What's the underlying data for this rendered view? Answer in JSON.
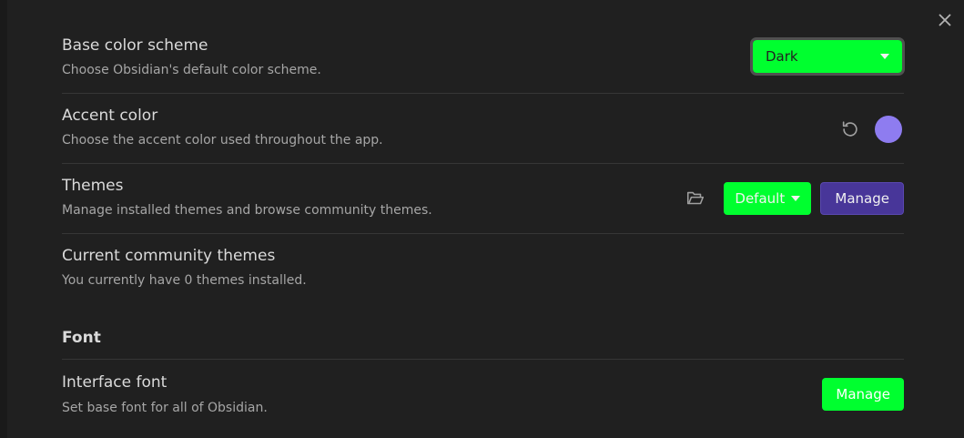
{
  "close_label": "✕",
  "settings": {
    "base_color_scheme": {
      "name": "Base color scheme",
      "desc": "Choose Obsidian's default color scheme.",
      "value": "Dark"
    },
    "accent_color": {
      "name": "Accent color",
      "desc": "Choose the accent color used throughout the app.",
      "color": "#8e7cf0"
    },
    "themes": {
      "name": "Themes",
      "desc": "Manage installed themes and browse community themes.",
      "value": "Default",
      "manage_label": "Manage"
    },
    "community_themes": {
      "name": "Current community themes",
      "desc": "You currently have 0 themes installed."
    },
    "font_heading": "Font",
    "interface_font": {
      "name": "Interface font",
      "desc": "Set base font for all of Obsidian.",
      "manage_label": "Manage"
    }
  },
  "colors": {
    "accent_green": "#00ff2f",
    "purple_button": "#483699",
    "background": "#202020"
  },
  "icons": [
    "close-icon",
    "reset-icon",
    "folder-open-icon",
    "chevron-down-icon"
  ]
}
